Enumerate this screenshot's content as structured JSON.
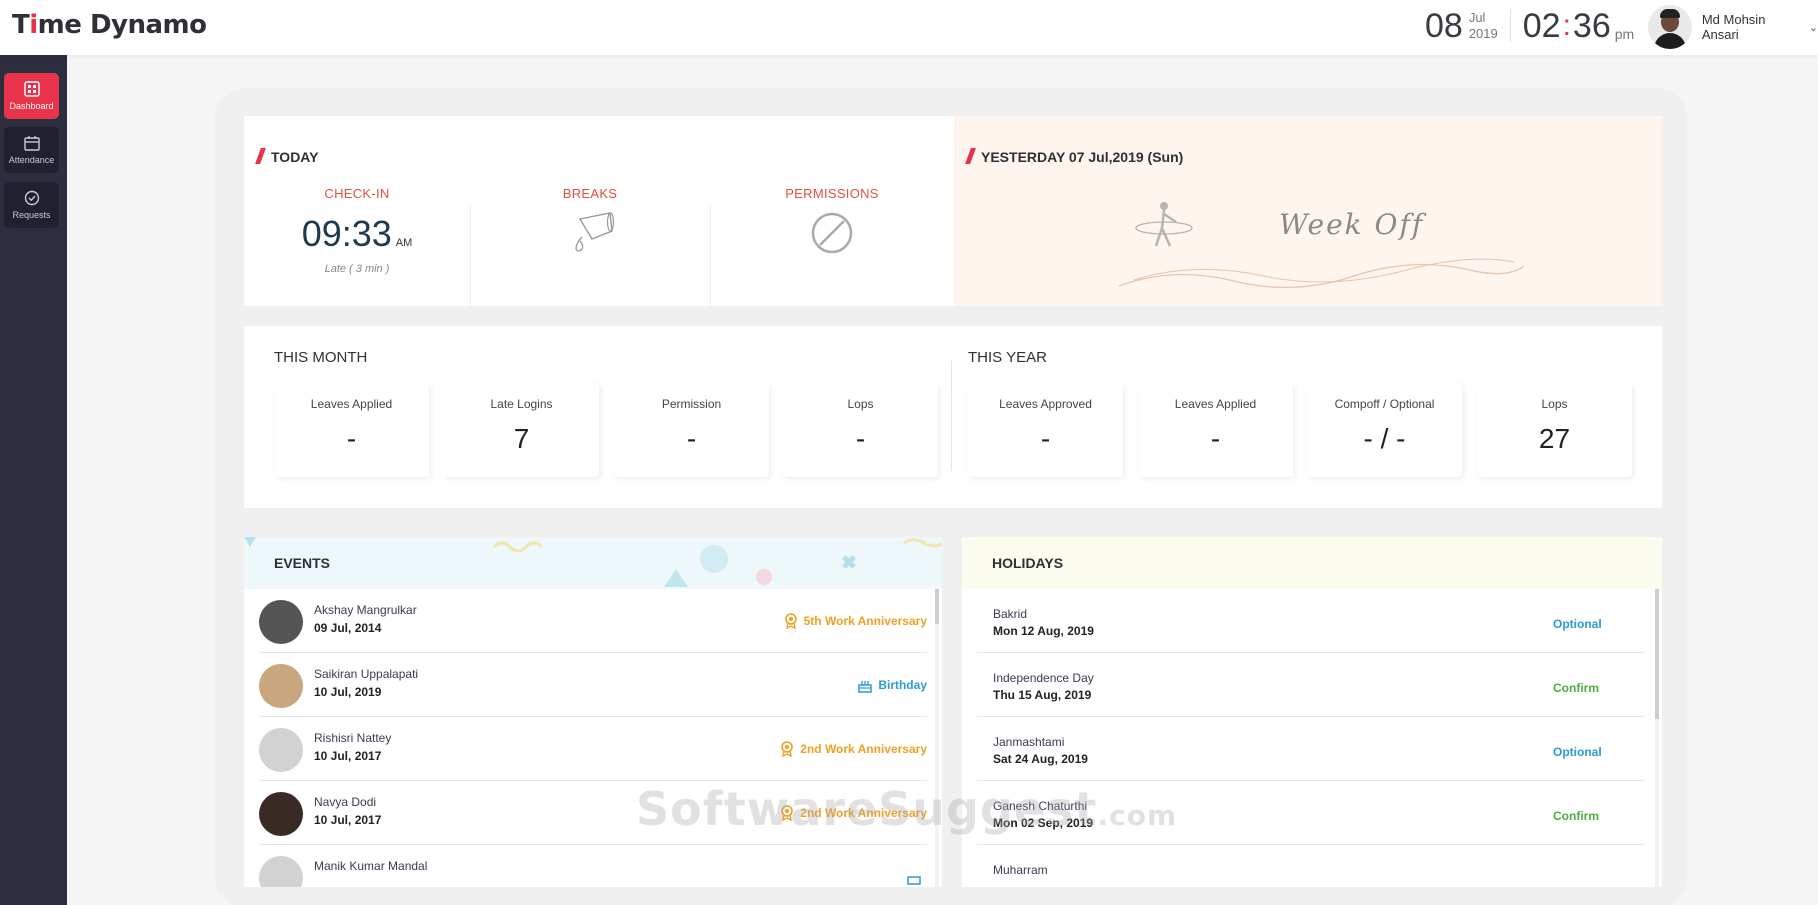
{
  "header": {
    "logo_prefix": "T",
    "logo_red": "i",
    "logo_mid": "me",
    "logo_suffix": " Dynamo",
    "day": "08",
    "month": "Jul",
    "year": "2019",
    "hour": "02",
    "minute": "36",
    "ampm": "pm",
    "user_name": "Md Mohsin Ansari"
  },
  "sidebar": {
    "items": [
      {
        "label": "Dashboard",
        "active": true
      },
      {
        "label": "Attendance"
      },
      {
        "label": "Requests"
      }
    ]
  },
  "today": {
    "title": "TODAY",
    "checkin_label": "CHECK-IN",
    "checkin_time": "09:33",
    "checkin_ampm": "AM",
    "late_note": "Late ( 3 min )",
    "breaks_label": "BREAKS",
    "permissions_label": "PERMISSIONS"
  },
  "yesterday": {
    "title": "YESTERDAY 07 Jul,2019 (Sun)",
    "status": "Week Off"
  },
  "this_month": {
    "title": "THIS MONTH",
    "stats": [
      {
        "label": "Leaves Applied",
        "value": "-"
      },
      {
        "label": "Late Logins",
        "value": "7"
      },
      {
        "label": "Permission",
        "value": "-"
      },
      {
        "label": "Lops",
        "value": "-"
      }
    ]
  },
  "this_year": {
    "title": "THIS YEAR",
    "stats": [
      {
        "label": "Leaves Approved",
        "value": "-"
      },
      {
        "label": "Leaves Applied",
        "value": "-"
      },
      {
        "label": "Compoff / Optional",
        "value": "- / -"
      },
      {
        "label": "Lops",
        "value": "27"
      }
    ]
  },
  "events": {
    "title": "EVENTS",
    "items": [
      {
        "name": "Akshay Mangrulkar",
        "date": "09 Jul, 2014",
        "tag": "5th Work Anniversary",
        "type": "anniversary"
      },
      {
        "name": "Saikiran Uppalapati",
        "date": "10 Jul, 2019",
        "tag": "Birthday",
        "type": "birthday"
      },
      {
        "name": "Rishisri Nattey",
        "date": "10 Jul, 2017",
        "tag": "2nd Work Anniversary",
        "type": "anniversary"
      },
      {
        "name": "Navya Dodi",
        "date": "10 Jul, 2017",
        "tag": "2nd Work Anniversary",
        "type": "anniversary"
      },
      {
        "name": "Manik Kumar Mandal",
        "date": "",
        "tag": "",
        "type": "birthday"
      }
    ]
  },
  "holidays": {
    "title": "HOLIDAYS",
    "items": [
      {
        "name": "Bakrid",
        "date": "Mon 12 Aug, 2019",
        "status": "Optional"
      },
      {
        "name": "Independence Day",
        "date": "Thu 15 Aug, 2019",
        "status": "Confirm"
      },
      {
        "name": "Janmashtami",
        "date": "Sat 24 Aug, 2019",
        "status": "Optional"
      },
      {
        "name": "Ganesh Chaturthi",
        "date": "Mon 02 Sep, 2019",
        "status": "Confirm"
      },
      {
        "name": "Muharram",
        "date": "",
        "status": ""
      }
    ]
  },
  "watermark": {
    "main": "SoftwareSuggest",
    "suffix": ".com"
  },
  "colors": {
    "accent": "#e8334a",
    "sidebar": "#2c2d3e",
    "optional": "#2a9bd6",
    "confirm": "#4cae3c",
    "anniversary": "#f0a020"
  }
}
